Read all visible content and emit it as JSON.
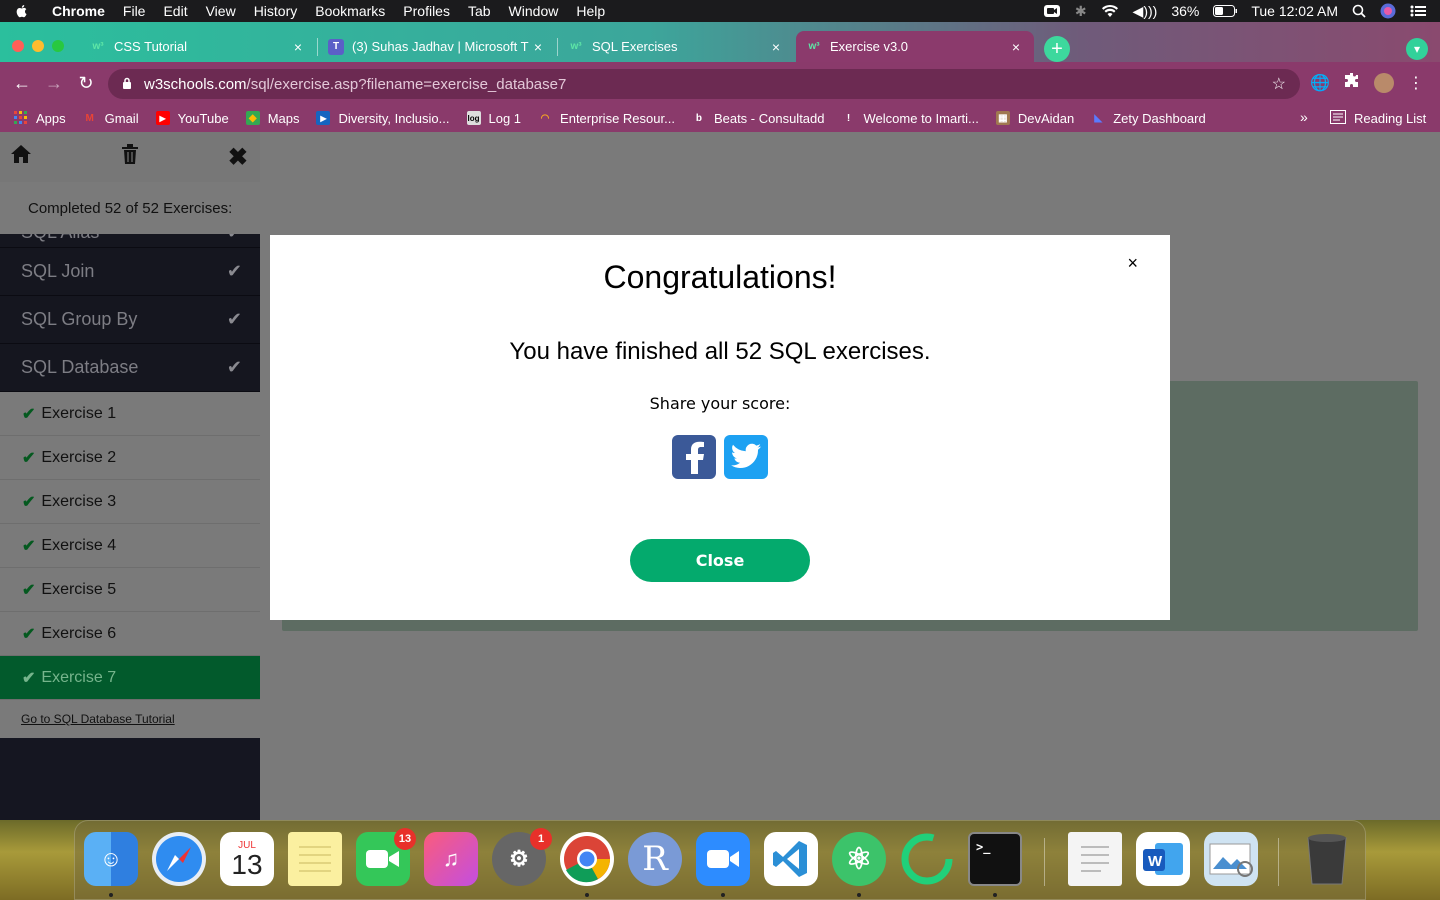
{
  "menubar": {
    "app": "Chrome",
    "items": [
      "File",
      "Edit",
      "View",
      "History",
      "Bookmarks",
      "Profiles",
      "Tab",
      "Window",
      "Help"
    ],
    "battery": "36%",
    "clock": "Tue 12:02 AM"
  },
  "tabs": [
    {
      "title": "CSS Tutorial"
    },
    {
      "title": "(3) Suhas Jadhav | Microsoft T"
    },
    {
      "title": "SQL Exercises"
    },
    {
      "title": "Exercise v3.0"
    }
  ],
  "address": {
    "domain": "w3schools.com",
    "path": "/sql/exercise.asp?filename=exercise_database7"
  },
  "bookmarks": [
    {
      "label": "Apps"
    },
    {
      "label": "Gmail"
    },
    {
      "label": "YouTube"
    },
    {
      "label": "Maps"
    },
    {
      "label": "Diversity, Inclusio..."
    },
    {
      "label": "Log 1"
    },
    {
      "label": "Enterprise Resour..."
    },
    {
      "label": "Beats - Consultadd"
    },
    {
      "label": "Welcome to Imarti..."
    },
    {
      "label": "DevAidan"
    },
    {
      "label": "Zety Dashboard"
    }
  ],
  "bookmarks_more": "»",
  "reading_list": "Reading List",
  "sidebar": {
    "completed": "Completed 52 of 52 Exercises:",
    "cut_section": "SQL Alias",
    "sections": [
      "SQL Join",
      "SQL Group By",
      "SQL Database"
    ],
    "exercises": [
      "Exercise 1",
      "Exercise 2",
      "Exercise 3",
      "Exercise 4",
      "Exercise 5",
      "Exercise 6",
      "Exercise 7"
    ],
    "active_exercise": "Exercise 7",
    "tutorial_link": "Go to SQL Database Tutorial"
  },
  "modal": {
    "close_x": "×",
    "title": "Congratulations!",
    "message": "You have finished all 52 SQL exercises.",
    "share": "Share your score:",
    "close_button": "Close"
  },
  "dock": {
    "calendar_month": "JUL",
    "calendar_day": "13",
    "facetime_badge": "13",
    "settings_badge": "1",
    "r_letter": "R"
  }
}
